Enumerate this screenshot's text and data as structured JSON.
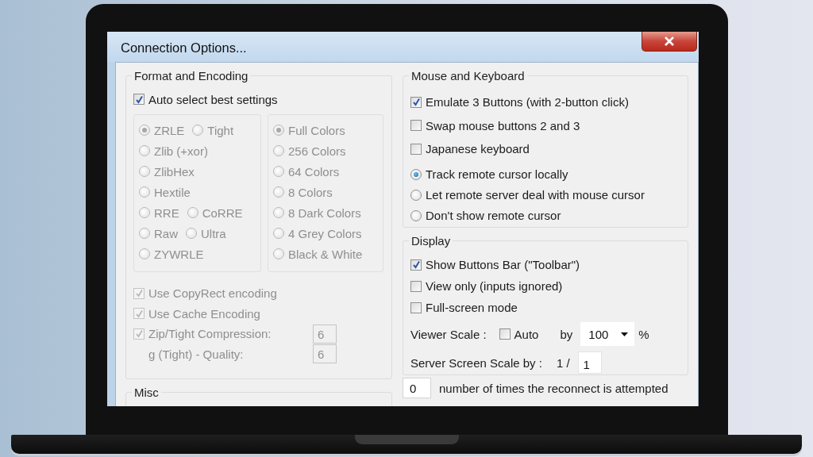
{
  "window": {
    "title": "Connection Options..."
  },
  "format_and_encoding": {
    "title": "Format and Encoding",
    "auto_select": {
      "label": "Auto select best settings",
      "checked": true
    },
    "encodings": {
      "disabled": true,
      "rows": [
        [
          {
            "label": "ZRLE",
            "selected": true
          },
          {
            "label": "Tight",
            "selected": false
          }
        ],
        [
          {
            "label": "Zlib (+xor)",
            "selected": false
          }
        ],
        [
          {
            "label": "ZlibHex",
            "selected": false
          }
        ],
        [
          {
            "label": "Hextile",
            "selected": false
          }
        ],
        [
          {
            "label": "RRE",
            "selected": false
          },
          {
            "label": "CoRRE",
            "selected": false
          }
        ],
        [
          {
            "label": "Raw",
            "selected": false
          },
          {
            "label": "Ultra",
            "selected": false
          }
        ],
        [
          {
            "label": "ZYWRLE",
            "selected": false
          }
        ]
      ]
    },
    "colors": {
      "disabled": true,
      "items": [
        {
          "label": "Full Colors",
          "selected": true
        },
        {
          "label": "256 Colors",
          "selected": false
        },
        {
          "label": "64 Colors",
          "selected": false
        },
        {
          "label": "8 Colors",
          "selected": false
        },
        {
          "label": "8 Dark Colors",
          "selected": false
        },
        {
          "label": "4 Grey Colors",
          "selected": false
        },
        {
          "label": "Black & White",
          "selected": false
        }
      ]
    },
    "options": [
      {
        "kind": "checkbox",
        "label": "Use CopyRect encoding",
        "checked": true,
        "disabled": true
      },
      {
        "kind": "checkbox",
        "label": "Use Cache Encoding",
        "checked": true,
        "disabled": true
      },
      {
        "kind": "checkbox-value",
        "label": "Zip/Tight Compression:",
        "checked": true,
        "disabled": true,
        "value": "6"
      },
      {
        "kind": "text-value",
        "label": "g (Tight) - Quality:",
        "disabled": true,
        "value": "6"
      }
    ]
  },
  "misc": {
    "title": "Misc"
  },
  "mouse_and_keyboard": {
    "title": "Mouse and Keyboard",
    "checkboxes": [
      {
        "label": "Emulate 3 Buttons (with 2-button click)",
        "checked": true
      },
      {
        "label": "Swap mouse buttons 2 and 3",
        "checked": false
      },
      {
        "label": "Japanese keyboard",
        "checked": false
      }
    ],
    "cursor_options": [
      {
        "label": "Track remote cursor locally",
        "selected": true
      },
      {
        "label": "Let remote server deal with mouse cursor",
        "selected": false
      },
      {
        "label": "Don't show remote cursor",
        "selected": false
      }
    ]
  },
  "display": {
    "title": "Display",
    "checkboxes": [
      {
        "label": "Show Buttons Bar (\"Toolbar\")",
        "checked": true
      },
      {
        "label": "View only (inputs ignored)",
        "checked": false
      },
      {
        "label": "Full-screen mode",
        "checked": false
      }
    ],
    "viewer_scale": {
      "label": "Viewer Scale :",
      "auto": {
        "label": "Auto",
        "checked": false
      },
      "by_label": "by",
      "value": "100",
      "unit": "%"
    },
    "server_scale": {
      "label": "Server Screen Scale by :",
      "prefix": "1 /",
      "value": "1"
    }
  },
  "reconnect": {
    "value": "0",
    "label": "number of times the reconnect is attempted"
  }
}
